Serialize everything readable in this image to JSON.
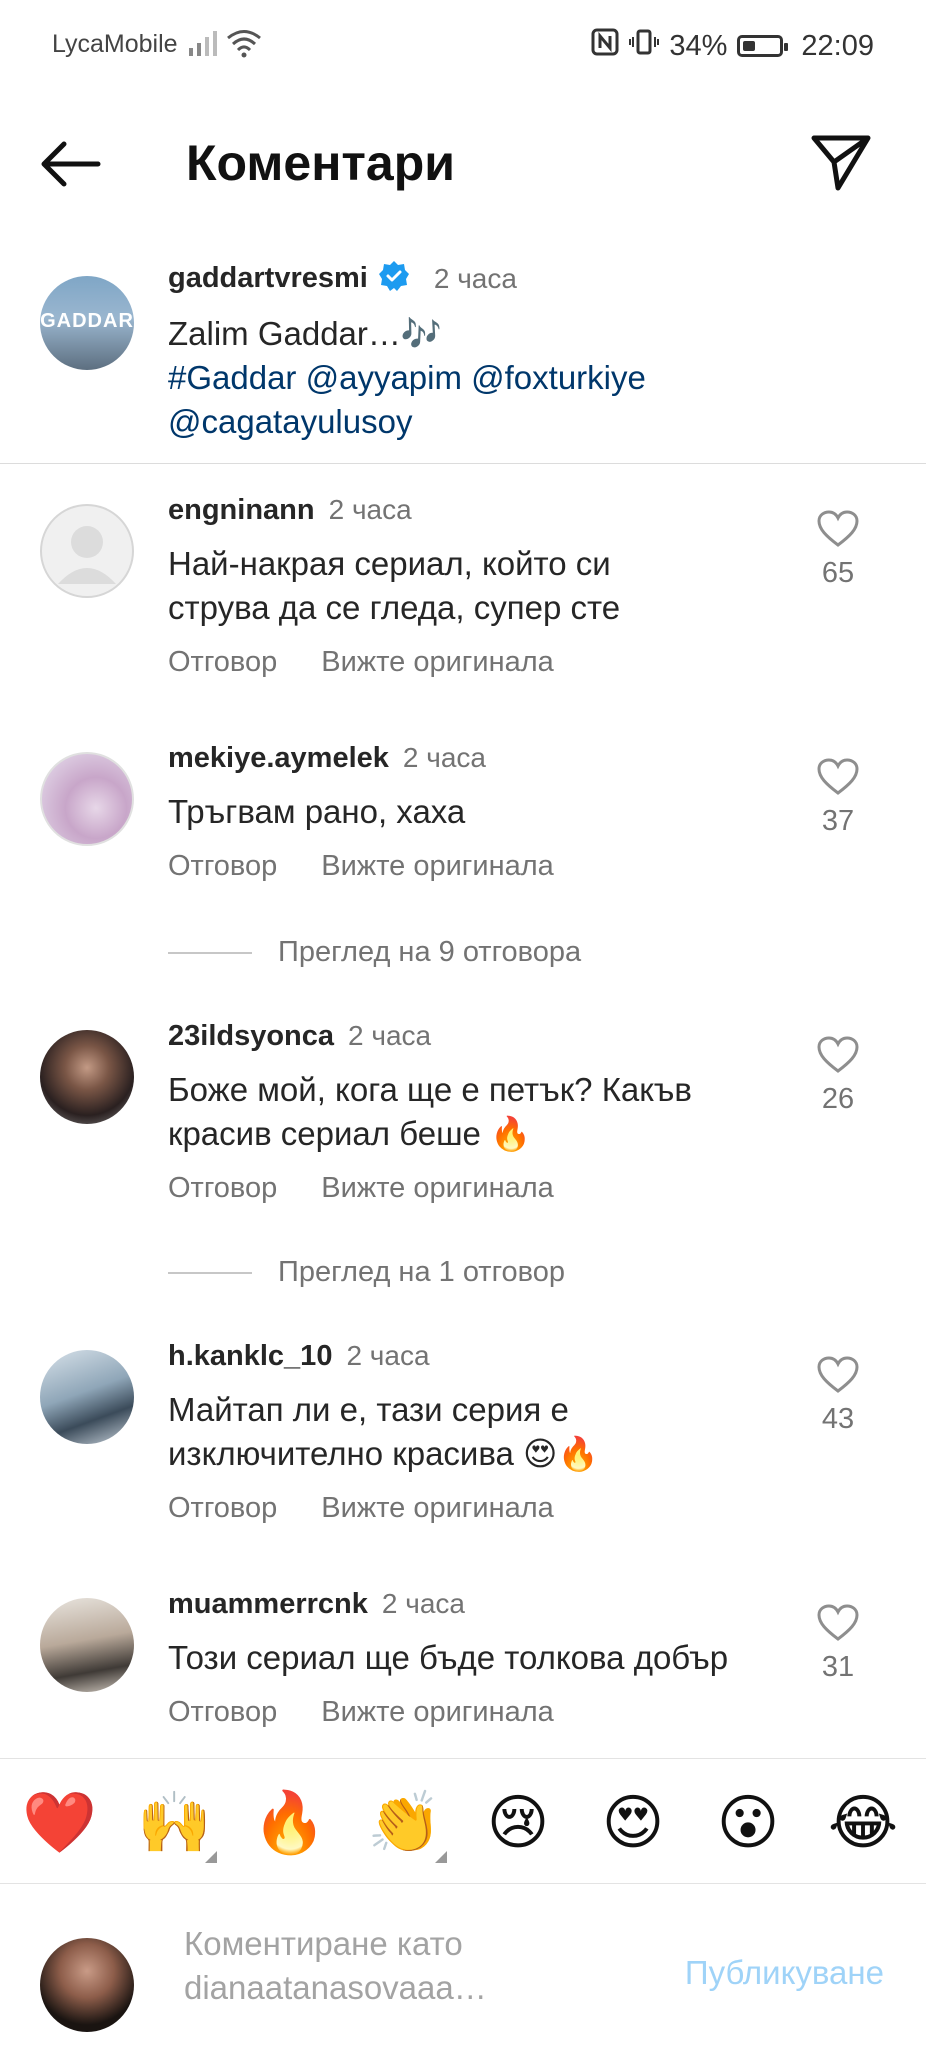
{
  "status_bar": {
    "carrier": "LycaMobile",
    "battery": "34%",
    "time": "22:09"
  },
  "header": {
    "title": "Коментари"
  },
  "caption": {
    "username": "gaddartvresmi",
    "time": "2 часа",
    "avatar_text": "GADDAR",
    "text": "Zalim Gaddar…🎶",
    "tags_line1": "#Gaddar @ayyapim @foxturkiye",
    "tags_line2": "@cagatayulusoy"
  },
  "actions": {
    "reply": "Отговор",
    "see_original": "Вижте оригинала"
  },
  "comments": [
    {
      "username": "engninann",
      "time": "2 часа",
      "text_line1": "Най-накрая сериал, който си",
      "text_line2": "струва да се гледа, супер сте",
      "likes": "65"
    },
    {
      "username": "mekiye.aymelek",
      "time": "2 часа",
      "text_line1": "Тръгвам рано, хаха",
      "text_line2": "",
      "likes": "37"
    },
    {
      "username": "23ildsyonca",
      "time": "2 часа",
      "text_line1": "Боже мой, кога ще е петък? Какъв",
      "text_line2": "красив сериал беше 🔥",
      "likes": "26"
    },
    {
      "username": "h.kanklc_10",
      "time": "2 часа",
      "text_line1": "Майтап ли е, тази серия е",
      "text_line2": "изключително красива 😍🔥",
      "likes": "43"
    },
    {
      "username": "muammerrcnk",
      "time": "2 часа",
      "text_line1": "Този сериал ще бъде толкова добър",
      "text_line2": "",
      "likes": "31"
    }
  ],
  "view_replies": [
    "Преглед на 9 отговора",
    "Преглед на 1 отговор"
  ],
  "emoji_bar": [
    "❤️",
    "🙌",
    "🔥",
    "👏",
    "😢",
    "😍",
    "😮",
    "😂"
  ],
  "composer": {
    "placeholder_line1": "Коментиране като",
    "placeholder_line2": "dianaatanasovaaa…",
    "publish_label": "Публикуване"
  },
  "colors": {
    "link": "#00376b",
    "verified": "#1d9bf0",
    "publish_disabled": "#9fd3f8",
    "secondary_text": "#737373"
  }
}
